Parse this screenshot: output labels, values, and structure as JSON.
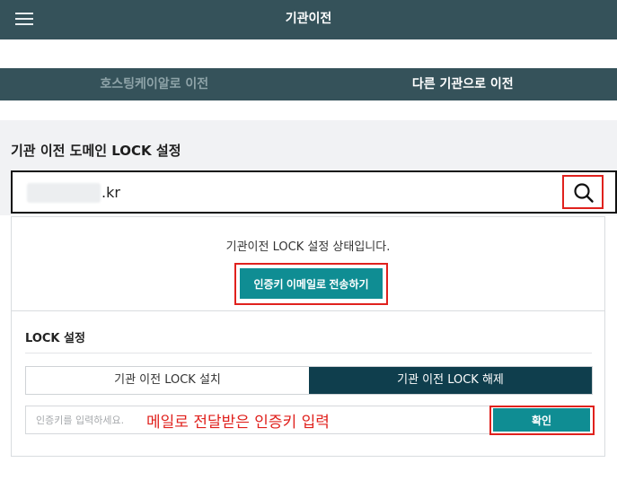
{
  "header": {
    "title": "기관이전",
    "menu_icon": "hamburger-menu-icon"
  },
  "tabs": [
    {
      "label": "호스팅케이알로 이전",
      "active": false
    },
    {
      "label": "다른 기관으로 이전",
      "active": true
    }
  ],
  "domain_lock": {
    "section_title": "기관 이전 도메인 LOCK 설정",
    "domain_suffix": ".kr",
    "search_icon": "search-icon"
  },
  "panel": {
    "status_text": "기관이전 LOCK 설정 상태입니다.",
    "send_button_label": "인증키 이메일로 전송하기",
    "lock_section_title": "LOCK 설정",
    "options": [
      {
        "label": "기관 이전 LOCK 설치",
        "selected": false
      },
      {
        "label": "기관 이전 LOCK 해제",
        "selected": true
      }
    ],
    "auth_placeholder": "인증키를 입력하세요.",
    "annotation": "메일로 전달받은 인증키 입력",
    "confirm_label": "확인"
  },
  "colors": {
    "header_bg": "#35525a",
    "primary_button": "#0f8d93",
    "selected_option": "#0f3e4d",
    "highlight_red": "#e0211d"
  }
}
